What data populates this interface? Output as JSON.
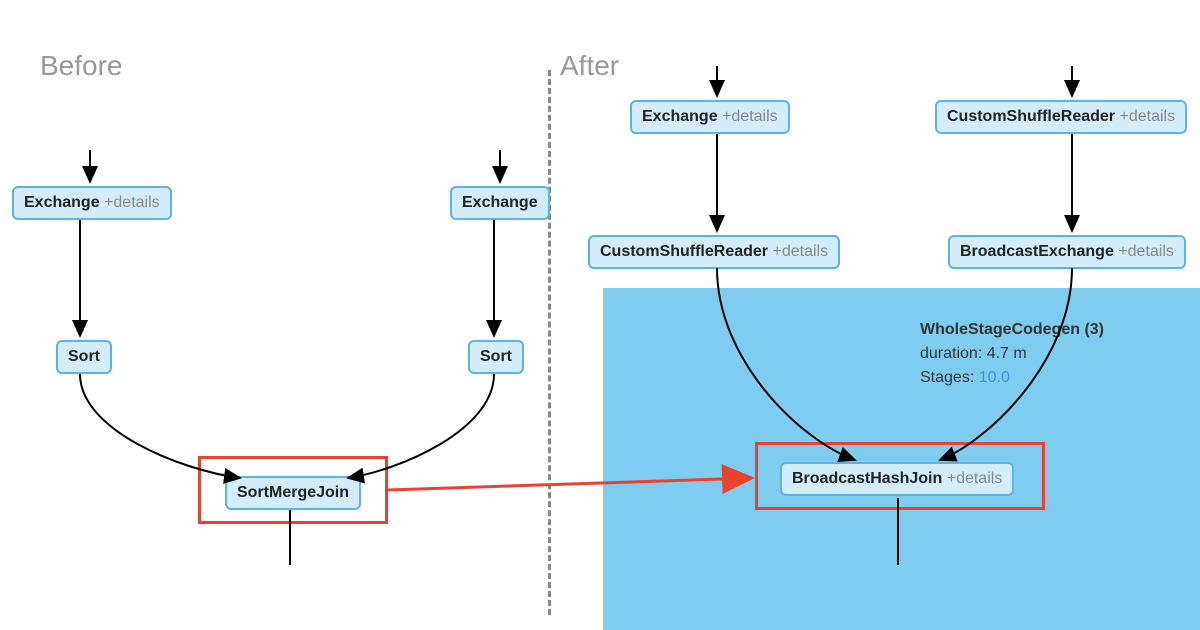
{
  "titles": {
    "before": "Before",
    "after": "After"
  },
  "nodes": {
    "b_exchange_left": {
      "label": "Exchange",
      "details": "+details"
    },
    "b_exchange_right": {
      "label": "Exchange",
      "details": ""
    },
    "b_sort_left": {
      "label": "Sort",
      "details": ""
    },
    "b_sort_right": {
      "label": "Sort",
      "details": ""
    },
    "b_join": {
      "label": "SortMergeJoin",
      "details": ""
    },
    "a_exchange": {
      "label": "Exchange",
      "details": "+details"
    },
    "a_csr_top": {
      "label": "CustomShuffleReader",
      "details": "+details"
    },
    "a_csr_left": {
      "label": "CustomShuffleReader",
      "details": "+details"
    },
    "a_bcast": {
      "label": "BroadcastExchange",
      "details": "+details"
    },
    "a_join": {
      "label": "BroadcastHashJoin",
      "details": "+details"
    }
  },
  "stage": {
    "title": "WholeStageCodegen (3)",
    "duration_label": "duration: 4.7 m",
    "stages_label": "Stages: ",
    "stages_value": "10.0"
  }
}
